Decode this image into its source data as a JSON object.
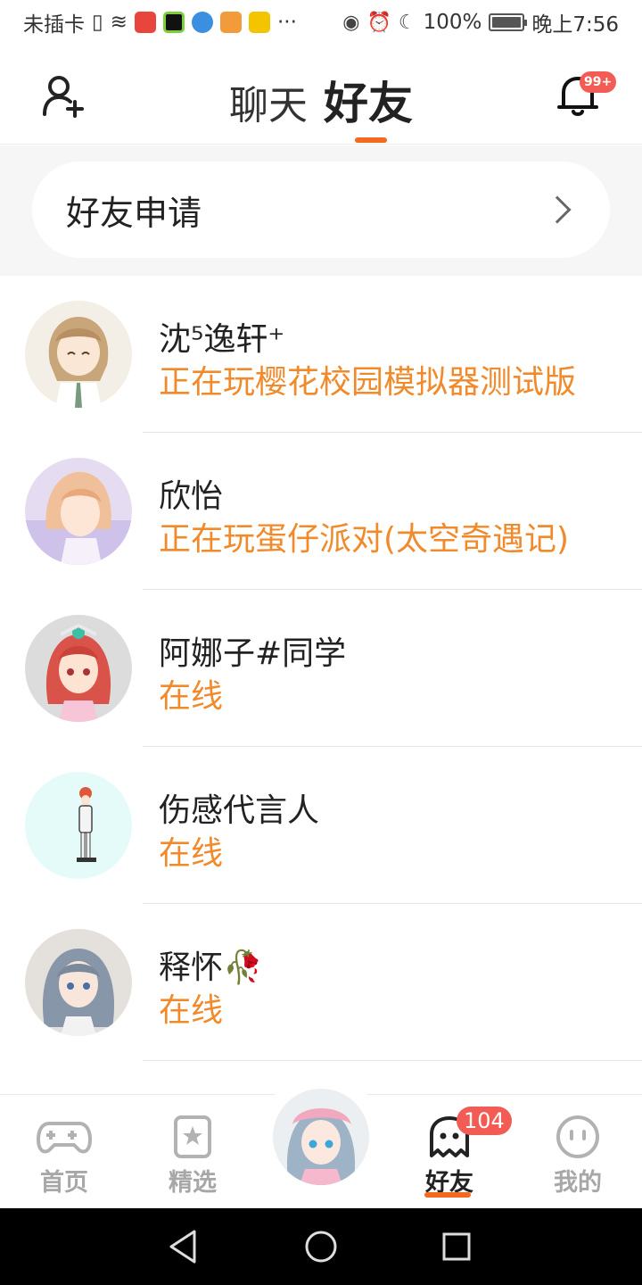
{
  "status_bar": {
    "carrier": "未插卡",
    "battery": "100%",
    "time": "晚上7:56",
    "more": "···"
  },
  "header": {
    "tab_chat": "聊天",
    "tab_friends": "好友",
    "notification_badge": "99+",
    "accent_color": "#f26b1d"
  },
  "friend_request": {
    "label": "好友申请"
  },
  "friends": [
    {
      "name": "沈⁵逸轩⁺",
      "status": "正在玩樱花校园模拟器测试版",
      "emoji": ""
    },
    {
      "name": "欣怡",
      "status": "正在玩蛋仔派对(太空奇遇记)",
      "emoji": ""
    },
    {
      "name": "阿娜子#同学",
      "status": "在线",
      "emoji": ""
    },
    {
      "name": "伤感代言人",
      "status": "在线",
      "emoji": ""
    },
    {
      "name": "释怀",
      "status": "在线",
      "emoji": "🥀"
    }
  ],
  "bottom_nav": {
    "items": [
      {
        "label": "首页",
        "icon": "gamepad-icon"
      },
      {
        "label": "精选",
        "icon": "star-bookmark-icon"
      },
      {
        "label": "好友",
        "icon": "ghost-icon",
        "badge": "104"
      },
      {
        "label": "我的",
        "icon": "smiley-icon"
      }
    ]
  }
}
